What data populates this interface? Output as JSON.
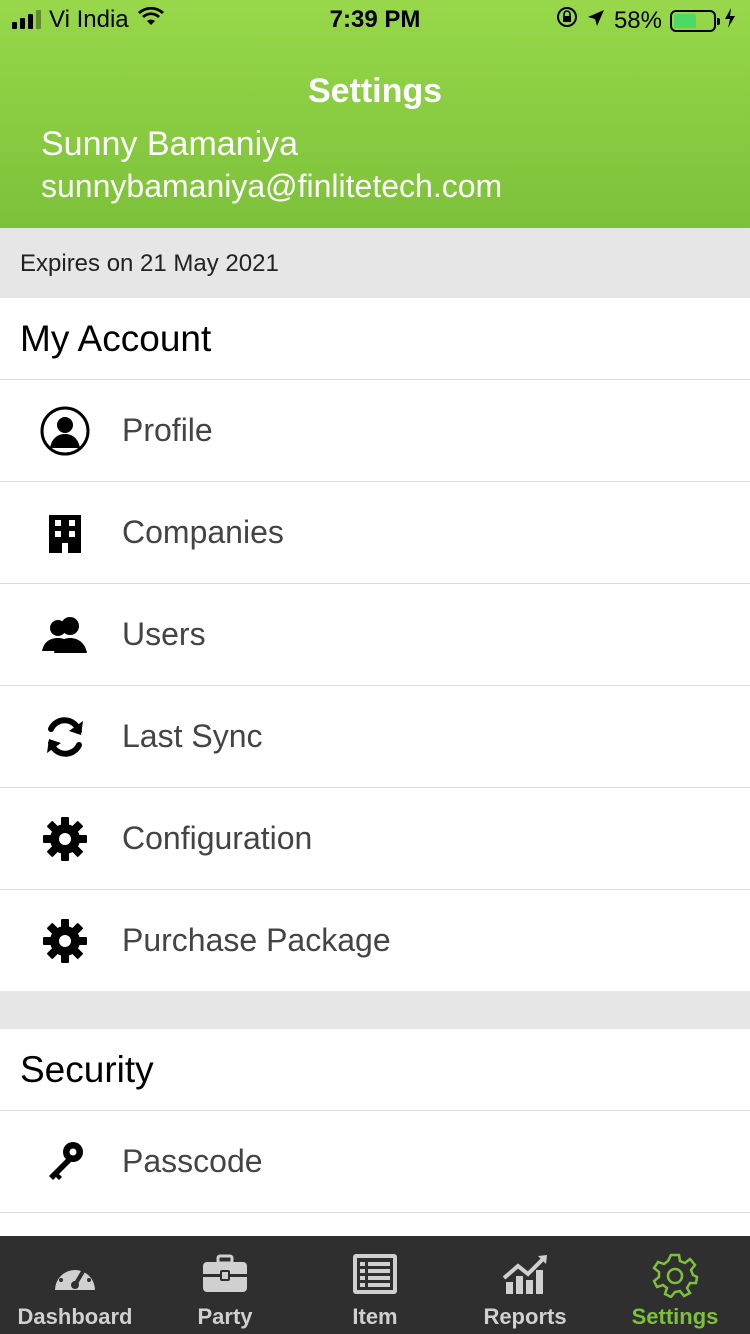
{
  "status_bar": {
    "carrier": "Vi India",
    "time": "7:39 PM",
    "battery_percent": "58%",
    "battery_level": 0.58
  },
  "header": {
    "title": "Settings",
    "user_name": "Sunny Bamaniya",
    "user_email": "sunnybamaniya@finlitetech.com"
  },
  "expiry": "Expires on 21 May 2021",
  "sections": {
    "my_account": {
      "title": "My Account",
      "items": [
        {
          "label": "Profile",
          "icon": "profile-icon"
        },
        {
          "label": "Companies",
          "icon": "building-icon"
        },
        {
          "label": "Users",
          "icon": "users-icon"
        },
        {
          "label": "Last Sync",
          "icon": "sync-icon"
        },
        {
          "label": "Configuration",
          "icon": "gear-icon"
        },
        {
          "label": "Purchase Package",
          "icon": "gear-icon"
        }
      ]
    },
    "security": {
      "title": "Security",
      "items": [
        {
          "label": "Passcode",
          "icon": "key-icon"
        }
      ]
    }
  },
  "tabbar": {
    "tabs": [
      {
        "label": "Dashboard",
        "icon": "speedometer-icon",
        "active": false
      },
      {
        "label": "Party",
        "icon": "briefcase-icon",
        "active": false
      },
      {
        "label": "Item",
        "icon": "list-icon",
        "active": false
      },
      {
        "label": "Reports",
        "icon": "chart-icon",
        "active": false
      },
      {
        "label": "Settings",
        "icon": "gear-icon",
        "active": true
      }
    ]
  },
  "colors": {
    "header_top": "#98d84a",
    "header_bottom": "#7cc13a",
    "tabbar_bg": "#2f2f2f",
    "active_tab": "#7cc13a"
  }
}
